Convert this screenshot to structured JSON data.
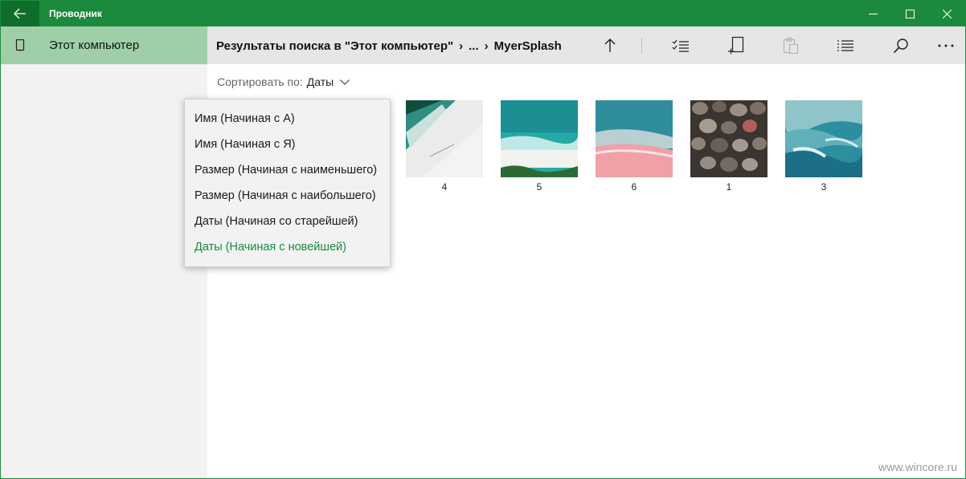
{
  "window": {
    "title": "Проводник",
    "accent_color": "#1b8a3d",
    "back_icon": "back-arrow-icon",
    "controls": [
      "minimize-icon",
      "maximize-icon",
      "close-icon"
    ]
  },
  "sidebar": {
    "items": [
      {
        "label": "Этот компьютер",
        "icon": "device-icon",
        "selected": true
      }
    ]
  },
  "breadcrumb": {
    "root": "Результаты поиска в \"Этот компьютер\"",
    "sep1": "›",
    "middle": "...",
    "sep2": "›",
    "current": "MyerSplash"
  },
  "toolbar": {
    "buttons": [
      "up-arrow-icon",
      "select-checklist-icon",
      "new-item-icon",
      "paste-icon",
      "view-list-icon",
      "search-icon",
      "more-icon"
    ]
  },
  "sort": {
    "label": "Сортировать по:",
    "value": "Даты"
  },
  "sort_menu": {
    "items": [
      {
        "label": "Имя (Начиная с А)",
        "selected": false
      },
      {
        "label": "Имя (Начиная с Я)",
        "selected": false
      },
      {
        "label": "Размер (Начиная с наименьшего)",
        "selected": false
      },
      {
        "label": "Размер (Начиная с наибольшего)",
        "selected": false
      },
      {
        "label": "Даты (Начиная со старейшей)",
        "selected": false
      },
      {
        "label": "Даты (Начиная с новейшей)",
        "selected": true
      }
    ]
  },
  "files": [
    {
      "name": "4",
      "thumbnail": "aerial-beach-green"
    },
    {
      "name": "5",
      "thumbnail": "aerial-beach-turquoise"
    },
    {
      "name": "6",
      "thumbnail": "pink-beach"
    },
    {
      "name": "1",
      "thumbnail": "pebbles"
    },
    {
      "name": "3",
      "thumbnail": "blue-water"
    }
  ],
  "watermark": "www.wincore.ru"
}
